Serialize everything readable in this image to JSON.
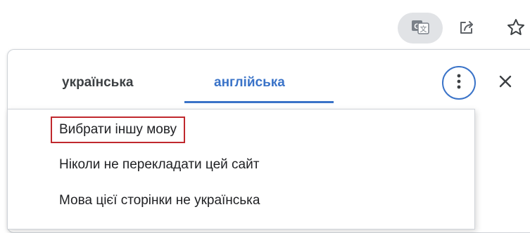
{
  "toolbar": {
    "icons": [
      "translate-icon",
      "share-icon",
      "star-icon"
    ]
  },
  "translate_bubble": {
    "source_language_tab": "українська",
    "target_language_tab": "англійська",
    "active_tab": "target",
    "accent_color": "#3a73c8",
    "icons": [
      "more-options-icon",
      "close-icon"
    ]
  },
  "options_menu": {
    "items": [
      {
        "label": "Вибрати іншу мову",
        "highlighted": true
      },
      {
        "label": "Ніколи не перекладати цей сайт",
        "highlighted": false
      },
      {
        "label": "Мова цієї сторінки не українська",
        "highlighted": false
      }
    ],
    "highlight_color": "#c0282d"
  }
}
